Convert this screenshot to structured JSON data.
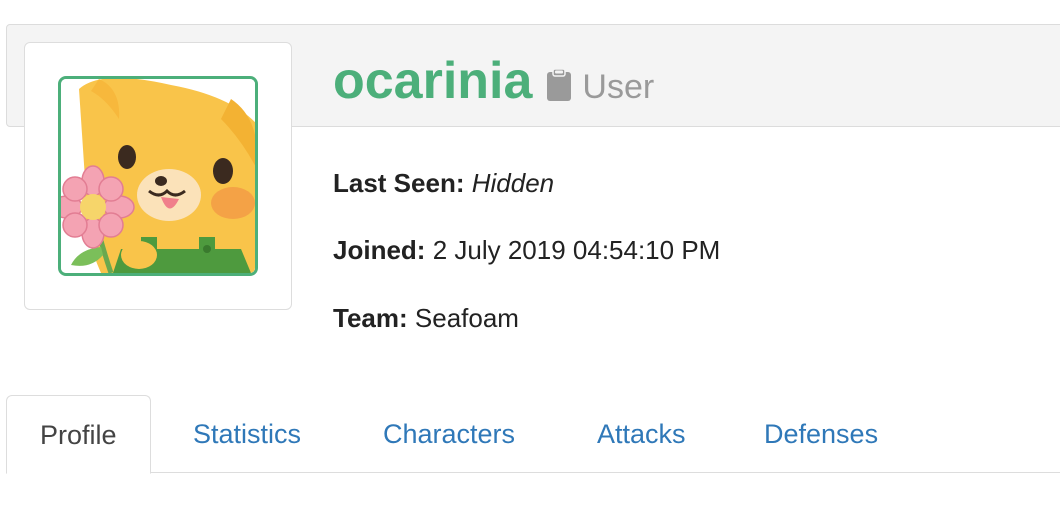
{
  "profile": {
    "username": "ocarinia",
    "role_icon": "clipboard-icon",
    "role": "User",
    "avatar_description_icon": "avatar-image",
    "last_seen_label": "Last Seen:",
    "last_seen_value": "Hidden",
    "joined_label": "Joined:",
    "joined_value": "2 July 2019 04:54:10 PM",
    "team_label": "Team:",
    "team_value": "Seafoam"
  },
  "tabs": [
    {
      "label": "Profile",
      "active": true
    },
    {
      "label": "Statistics",
      "active": false
    },
    {
      "label": "Characters",
      "active": false
    },
    {
      "label": "Attacks",
      "active": false
    },
    {
      "label": "Defenses",
      "active": false
    }
  ],
  "colors": {
    "accent_green": "#4caf7a",
    "link_blue": "#2f78b8",
    "muted_grey": "#9a9a9a"
  }
}
